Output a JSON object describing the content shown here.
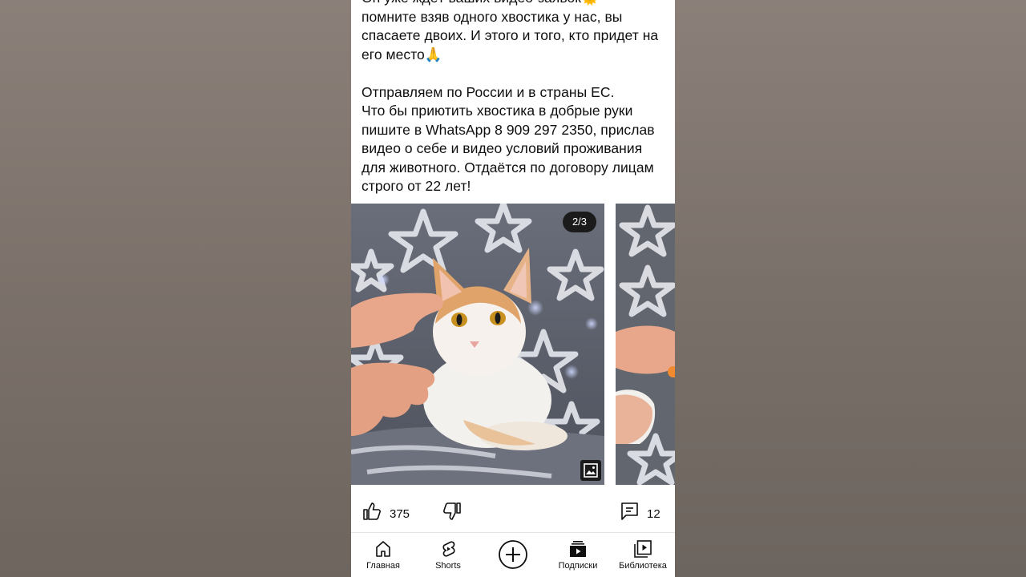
{
  "post": {
    "text": "Он уже ждёт ваших видео-заявок🌞\nпомните взяв одного хвостика у нас, вы спасаете двоих. И этого и того, кто придет на его место🙏\n\nОтправляем по России и в страны ЕС.\nЧто бы приютить хвостика в добрые руки пишите в WhatsApp 8 909 297 2350, прислав видео о себе и видео условий проживания для животного. Отдаётся по договору лицам строго от 22 лет!"
  },
  "carousel": {
    "counter": "2/3",
    "icon": "image-icon"
  },
  "actions": {
    "likes": "375",
    "comments": "12",
    "like_icon": "thumb-up-icon",
    "dislike_icon": "thumb-down-icon",
    "comment_icon": "comment-icon"
  },
  "nav": {
    "home": "Главная",
    "shorts": "Shorts",
    "subscriptions": "Подписки",
    "library": "Библиотека"
  },
  "colors": {
    "text": "#0f0f0f",
    "background": "#ffffff",
    "badge": "#1b1b1b"
  }
}
